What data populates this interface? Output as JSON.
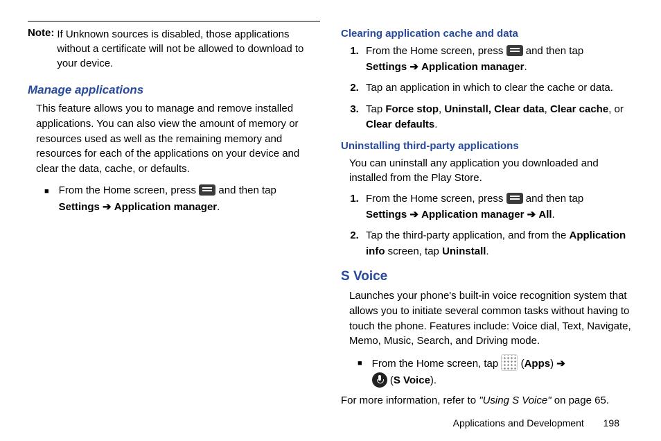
{
  "left": {
    "note_label": "Note:",
    "note_text": "If Unknown sources is disabled, those applications without a certificate will not be allowed to download to your device.",
    "manage_heading": "Manage applications",
    "manage_intro": "This feature allows you to manage and remove installed applications. You can also view the amount of memory or resources used as well as the remaining memory and resources for each of the applications on your device and clear the data, cache, or defaults.",
    "bullet_pre": "From the Home screen, press",
    "bullet_post": "and then tap",
    "settings": "Settings",
    "arrow": "➔",
    "app_manager": "Application manager",
    "period": "."
  },
  "right": {
    "clear_heading": "Clearing application cache and data",
    "step1_pre": "From the Home screen, press",
    "step1_post": "and then tap",
    "settings": "Settings",
    "arrow": "➔",
    "app_manager": "Application manager",
    "step2": "Tap an application in which to clear the cache or data.",
    "step3_pre": "Tap",
    "force_stop": "Force stop",
    "comma": ", ",
    "uninstall_clear_data": "Uninstall, Clear data",
    "clear_cache": "Clear cache",
    "or": ", or",
    "clear_defaults": "Clear defaults",
    "period": ".",
    "uninstall_heading": "Uninstalling third-party applications",
    "uninstall_intro": "You can uninstall any application you downloaded and installed from the Play Store.",
    "u_step1_pre": "From the Home screen, press",
    "u_step1_post": "and then tap",
    "all": "All",
    "u_step2_a": "Tap the third-party application, and from the",
    "app_info": "Application info",
    "u_step2_b": "screen, tap",
    "uninstall": "Uninstall",
    "svoice_heading": "S Voice",
    "svoice_intro": "Launches your phone's built-in voice recognition system that allows you to initiate several common tasks without having to touch the phone. Features include: Voice dial, Text, Navigate, Memo, Music, Search, and Driving mode.",
    "sv_bullet_pre": "From the Home screen, tap",
    "apps_label": "Apps",
    "svoice_label": "S Voice",
    "open_paren": "(",
    "close_paren": ")",
    "more_info_pre": "For more information, refer to",
    "more_info_ref": "\"Using S Voice\"",
    "more_info_post": "on page 65."
  },
  "footer": {
    "section": "Applications and Development",
    "page": "198"
  }
}
